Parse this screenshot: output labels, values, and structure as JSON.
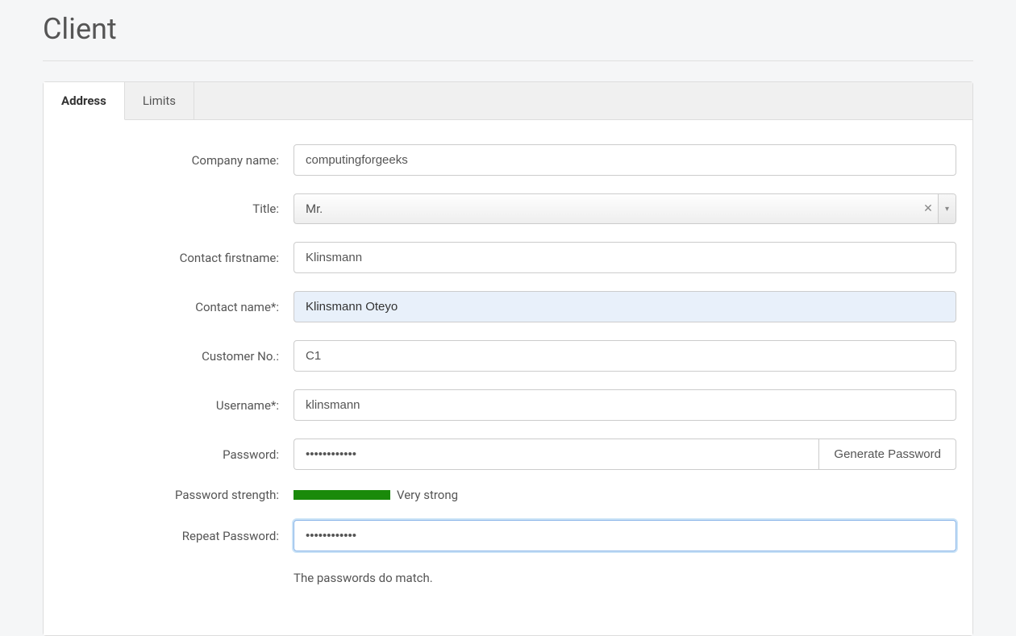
{
  "page": {
    "title": "Client"
  },
  "tabs": {
    "address": "Address",
    "limits": "Limits"
  },
  "labels": {
    "company_name": "Company name:",
    "title": "Title:",
    "contact_firstname": "Contact firstname:",
    "contact_name": "Contact name*:",
    "customer_no": "Customer No.:",
    "username": "Username*:",
    "password": "Password:",
    "password_strength": "Password strength:",
    "repeat_password": "Repeat Password:"
  },
  "values": {
    "company_name": "computingforgeeks",
    "title": "Mr.",
    "contact_firstname": "Klinsmann",
    "contact_name": "Klinsmann Oteyo",
    "customer_no": "C1",
    "username": "klinsmann",
    "password": "••••••••••••",
    "repeat_password": "••••••••••••"
  },
  "buttons": {
    "generate_password": "Generate Password"
  },
  "strength": {
    "text": "Very strong"
  },
  "messages": {
    "password_match": "The passwords do match."
  },
  "icons": {
    "clear": "✕",
    "caret": "▾"
  }
}
